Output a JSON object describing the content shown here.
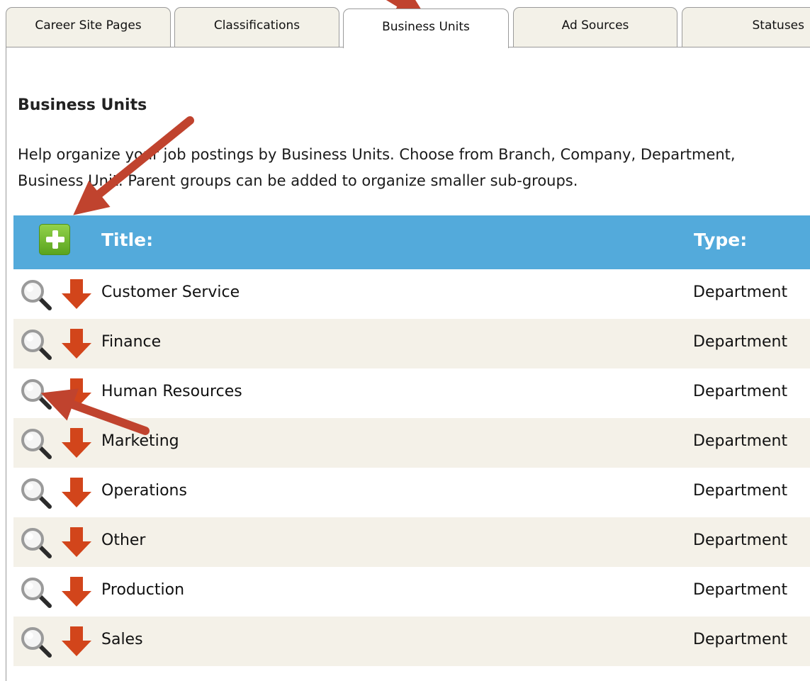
{
  "tabs": [
    {
      "label": "Career Site Pages"
    },
    {
      "label": "Classifications"
    },
    {
      "label": "Business Units"
    },
    {
      "label": "Ad Sources"
    },
    {
      "label": "Statuses"
    }
  ],
  "section": {
    "title": "Business Units",
    "description_line1": "Help organize your job postings by Business Units. Choose from Branch, Company, Department,",
    "description_line2": "Business Unit. Parent groups can be added to organize smaller sub-groups."
  },
  "table": {
    "columns": {
      "title": "Title:",
      "type": "Type:"
    },
    "rows": [
      {
        "title": "Customer Service",
        "type": "Department"
      },
      {
        "title": "Finance",
        "type": "Department"
      },
      {
        "title": "Human Resources",
        "type": "Department"
      },
      {
        "title": "Marketing",
        "type": "Department"
      },
      {
        "title": "Operations",
        "type": "Department"
      },
      {
        "title": "Other",
        "type": "Department"
      },
      {
        "title": "Production",
        "type": "Department"
      },
      {
        "title": "Sales",
        "type": "Department"
      }
    ]
  },
  "icons": {
    "add": "plus-icon",
    "view": "magnifier-icon",
    "move": "down-arrow-icon"
  },
  "colors": {
    "header_bg": "#53aadb",
    "row_alt_bg": "#f4f1e8",
    "add_green": "#6ab82a",
    "arrow_red": "#d2451b",
    "annotation": "#c0432e"
  }
}
